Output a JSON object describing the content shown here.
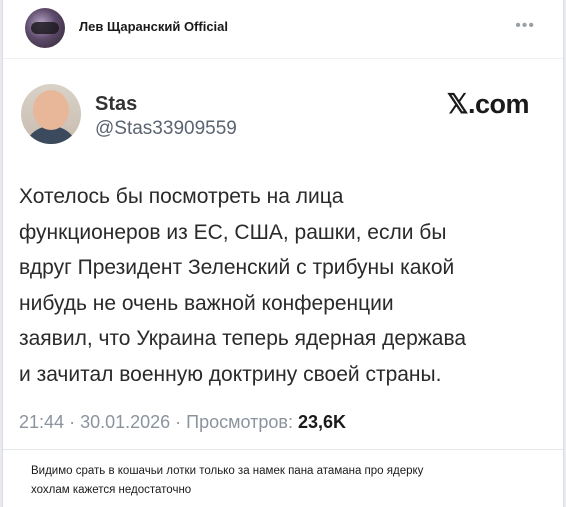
{
  "channel": {
    "name": "Лев Щаранский Official",
    "more_icon": "more-horizontal-icon"
  },
  "tweet": {
    "author_name": "Stas",
    "author_handle": "@Stas33909559",
    "brand": "𝕏.com",
    "text": "Хотелось бы посмотреть на лица\nфункционеров из ЕС, США, рашки, если бы\nвдруг Президент Зеленский с трибуны какой\nнибудь не очень важной конференции\nзаявил, что Украина теперь ядерная держава\nи зачитал военную доктрину своей страны.",
    "time": "21:44",
    "date": "30.01.2026",
    "views_label": "Просмотров:",
    "views_count": "23,6K"
  },
  "caption": "Видимо срать в кошачьи лотки только за намек пана атамана про ядерку\nхохлам кажется недостаточно",
  "colors": {
    "background": "#e9ebee",
    "card": "#ffffff",
    "meta_text": "#8b949e",
    "handle_text": "#5b6470"
  }
}
